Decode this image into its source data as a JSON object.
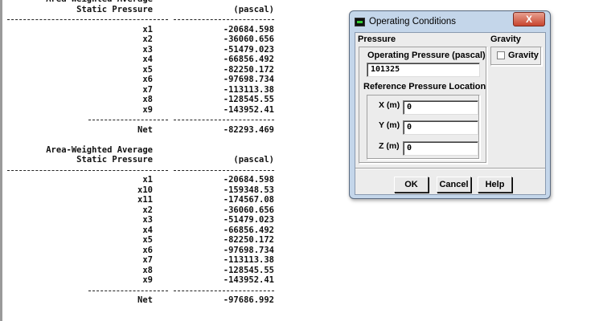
{
  "console": {
    "tables": [
      {
        "title": "Area-Weighted Average",
        "subtitle": "Static Pressure",
        "unit": "(pascal)",
        "rows": [
          [
            "x1",
            "-20684.598"
          ],
          [
            "x2",
            "-36060.656"
          ],
          [
            "x3",
            "-51479.023"
          ],
          [
            "x4",
            "-66856.492"
          ],
          [
            "x5",
            "-82250.172"
          ],
          [
            "x6",
            "-97698.734"
          ],
          [
            "x7",
            "-113113.38"
          ],
          [
            "x8",
            "-128545.55"
          ],
          [
            "x9",
            "-143952.41"
          ]
        ],
        "net_label": "Net",
        "net": "-82293.469"
      },
      {
        "title": "Area-Weighted Average",
        "subtitle": "Static Pressure",
        "unit": "(pascal)",
        "rows": [
          [
            "x1",
            "-20684.598"
          ],
          [
            "x10",
            "-159348.53"
          ],
          [
            "x11",
            "-174567.08"
          ],
          [
            "x2",
            "-36060.656"
          ],
          [
            "x3",
            "-51479.023"
          ],
          [
            "x4",
            "-66856.492"
          ],
          [
            "x5",
            "-82250.172"
          ],
          [
            "x6",
            "-97698.734"
          ],
          [
            "x7",
            "-113113.38"
          ],
          [
            "x8",
            "-128545.55"
          ],
          [
            "x9",
            "-143952.41"
          ]
        ],
        "net_label": "Net",
        "net": "-97686.992"
      }
    ]
  },
  "dialog": {
    "title": "Operating Conditions",
    "close": "X",
    "pressure_group": "Pressure",
    "op_pressure_label": "Operating Pressure (pascal)",
    "op_pressure_value": "101325",
    "ref_group": "Reference Pressure Location",
    "x_label": "X (m)",
    "x_value": "0",
    "y_label": "Y (m)",
    "y_value": "0",
    "z_label": "Z (m)",
    "z_value": "0",
    "gravity_group": "Gravity",
    "gravity_checkbox": "Gravity",
    "gravity_checked": false,
    "ok": "OK",
    "cancel": "Cancel",
    "help": "Help"
  }
}
